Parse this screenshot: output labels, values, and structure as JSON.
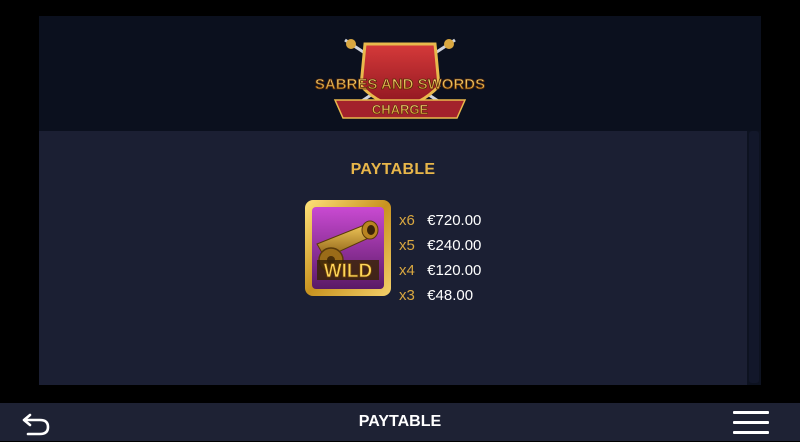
{
  "logo": {
    "line1": "SABRES AND SWORDS",
    "line2": "CHARGE"
  },
  "paytable": {
    "title": "PAYTABLE",
    "symbol": {
      "icon": "wild-cannon-icon",
      "label": "WILD",
      "payouts": [
        {
          "multiplier": "x6",
          "amount": "€720.00"
        },
        {
          "multiplier": "x5",
          "amount": "€240.00"
        },
        {
          "multiplier": "x4",
          "amount": "€120.00"
        },
        {
          "multiplier": "x3",
          "amount": "€48.00"
        }
      ]
    }
  },
  "bottom_bar": {
    "title": "PAYTABLE",
    "back_icon": "back-arrow-icon",
    "menu_icon": "hamburger-menu-icon"
  },
  "colors": {
    "gold": "#e8b64a",
    "panel": "#1b1f33",
    "header": "#0b101e"
  }
}
